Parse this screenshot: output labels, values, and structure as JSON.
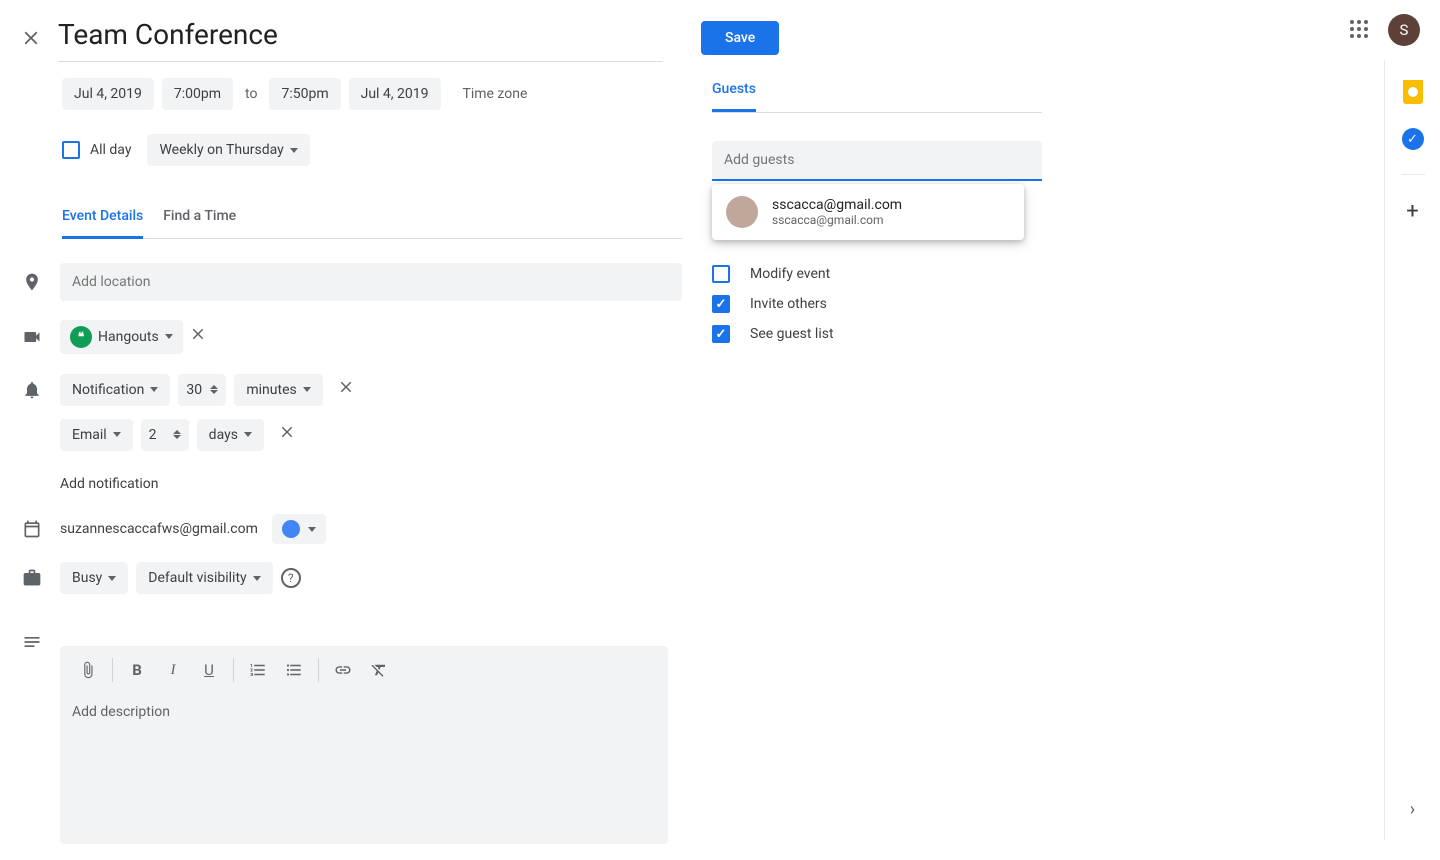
{
  "header": {
    "title_value": "Team Conference",
    "save_label": "Save",
    "avatar_initial": "S"
  },
  "datetime": {
    "start_date": "Jul 4, 2019",
    "start_time": "7:00pm",
    "to_label": "to",
    "end_time": "7:50pm",
    "end_date": "Jul 4, 2019",
    "timezone_label": "Time zone",
    "all_day_label": "All day",
    "recurrence_label": "Weekly on Thursday"
  },
  "tabs": {
    "details": "Event Details",
    "find_time": "Find a Time"
  },
  "location": {
    "placeholder": "Add location"
  },
  "conference": {
    "label": "Hangouts"
  },
  "notifications": [
    {
      "method": "Notification",
      "value": "30",
      "unit": "minutes"
    },
    {
      "method": "Email",
      "value": "2",
      "unit": "days"
    }
  ],
  "add_notification_label": "Add notification",
  "calendar": {
    "owner": "suzannescaccafws@gmail.com",
    "color": "#4285f4"
  },
  "availability": {
    "status": "Busy",
    "visibility": "Default visibility"
  },
  "description": {
    "placeholder": "Add description"
  },
  "guests": {
    "tab_label": "Guests",
    "input_placeholder": "Add guests",
    "suggestion": {
      "name": "sscacca@gmail.com",
      "email": "sscacca@gmail.com"
    },
    "permissions": {
      "modify_label": "Modify event",
      "invite_label": "Invite others",
      "see_list_label": "See guest list"
    }
  }
}
